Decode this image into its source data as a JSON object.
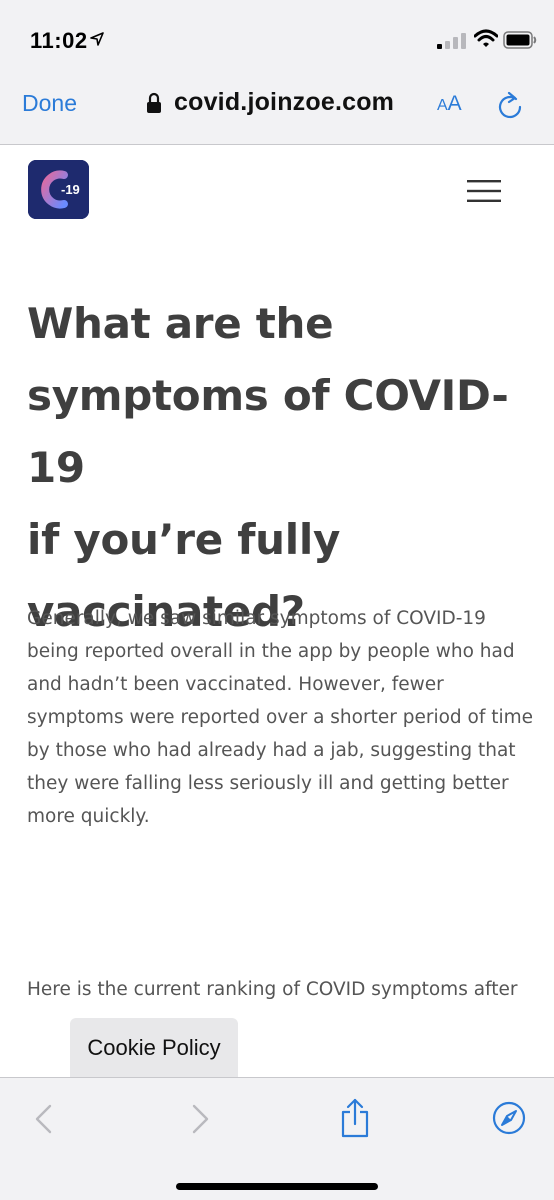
{
  "status_bar": {
    "time": "11:02",
    "icons": [
      "location-arrow-icon",
      "cellular-signal-icon",
      "wifi-icon",
      "battery-icon"
    ]
  },
  "browser": {
    "done_label": "Done",
    "url": "covid.joinzoe.com",
    "text_size_label_small": "A",
    "text_size_label_large": "A",
    "accent_color": "#2b7bd8"
  },
  "page": {
    "logo_text": "-19",
    "headline_lines": [
      "What are the",
      "symptoms of COVID-19",
      "if you’re fully",
      "vaccinated?"
    ],
    "paragraph_1": "Generally, we saw similar symptoms of COVID-19 being reported overall in the app by people who had and hadn’t been vaccinated. However, fewer symptoms were reported over a shorter period of time by those who had already had a jab, suggesting that they were falling less seriously ill and getting better more quickly.",
    "paragraph_2": "Here is the current ranking of COVID symptoms after"
  },
  "cookie": {
    "label": "Cookie Policy"
  },
  "toolbar": {
    "icons": [
      "back-icon",
      "forward-icon",
      "share-icon",
      "compass-icon"
    ]
  }
}
